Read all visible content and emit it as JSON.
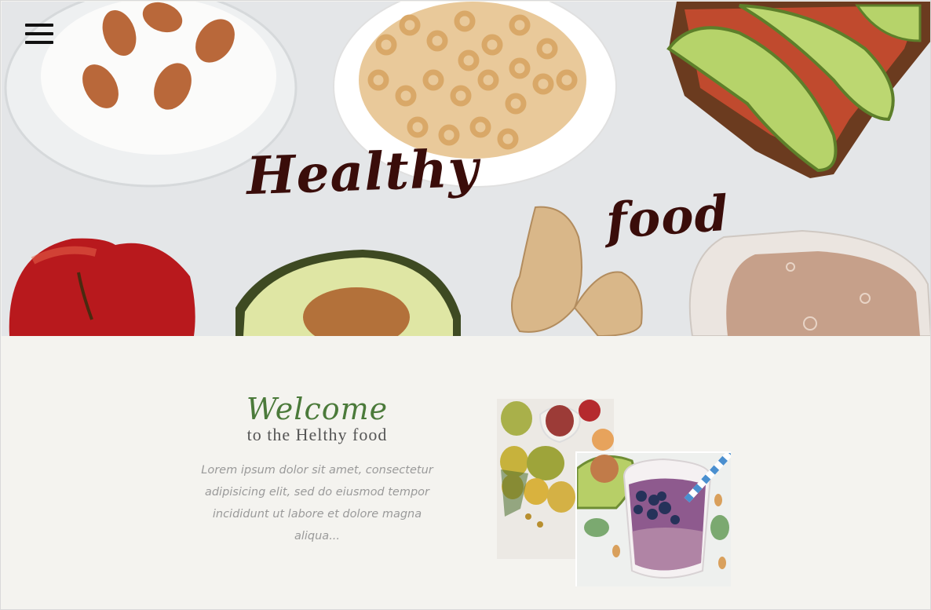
{
  "hero": {
    "menu_icon": "hamburger-menu-icon",
    "title_word_1": "Healthy",
    "title_word_2": "food"
  },
  "welcome": {
    "script_title": "Welcome",
    "subtitle": "to the Helthy food",
    "paragraph_lines": [
      "Lorem ipsum dolor sit amet, consectetur",
      "adipisicing elit, sed do eiusmod tempor",
      "incididunt ut labore et dolore magna aliqua..."
    ]
  },
  "colors": {
    "hero_bg": "#e4e6e8",
    "page_bg": "#f4f3ef",
    "title_brown": "#3a0d0a",
    "welcome_green": "#4b7a3a",
    "paragraph_gray": "#9a9a9a"
  }
}
